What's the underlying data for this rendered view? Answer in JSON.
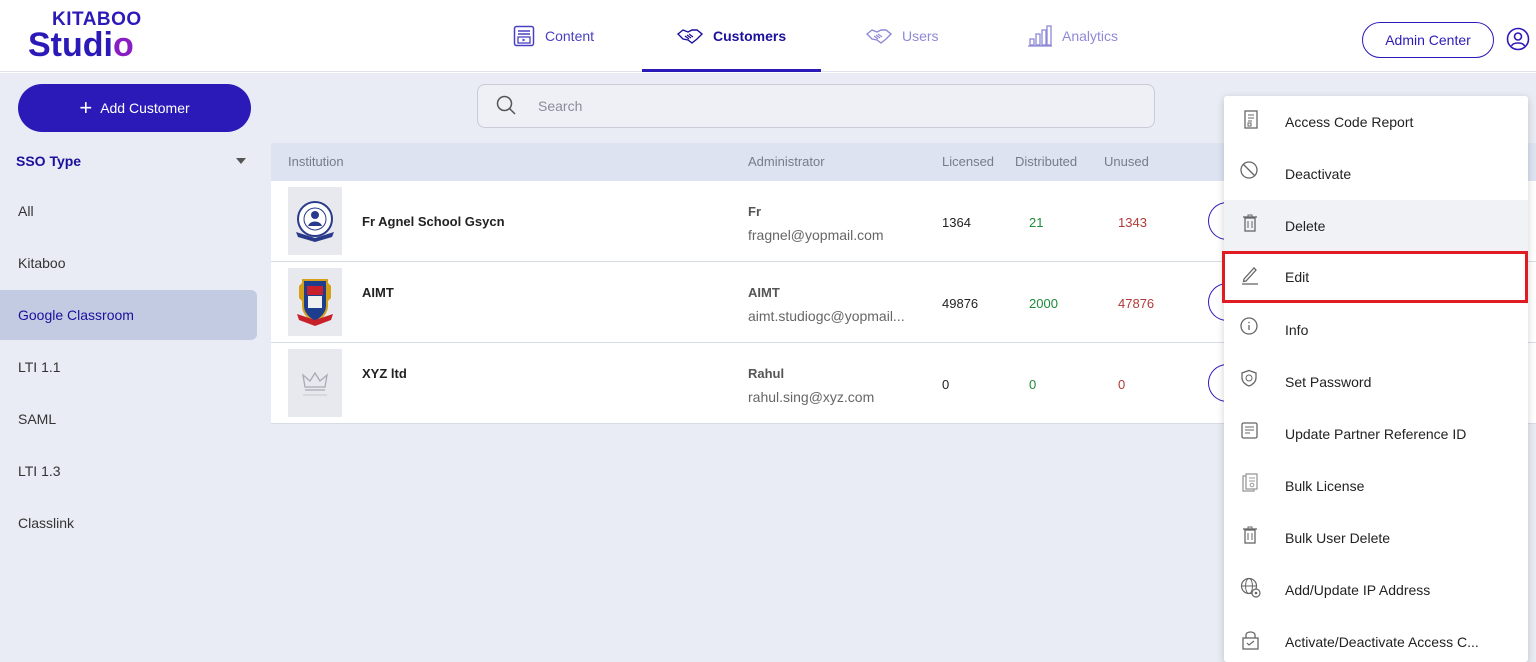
{
  "logo": {
    "top": "KITABOO",
    "bottom_main": "Studi",
    "bottom_accent": "o"
  },
  "nav": {
    "content": "Content",
    "customers": "Customers",
    "users": "Users",
    "analytics": "Analytics"
  },
  "header": {
    "admin_center": "Admin Center"
  },
  "sidebar": {
    "add_customer": "Add Customer",
    "sso_type": "SSO Type",
    "items": [
      "All",
      "Kitaboo",
      "Google Classroom",
      "LTI 1.1",
      "SAML",
      "LTI 1.3",
      "Classlink"
    ],
    "selected": "Google Classroom"
  },
  "search": {
    "placeholder": "Search"
  },
  "table": {
    "columns": {
      "institution": "Institution",
      "administrator": "Administrator",
      "licensed": "Licensed",
      "distributed": "Distributed",
      "unused": "Unused"
    },
    "rows": [
      {
        "institution": "Fr Agnel School Gsycn",
        "admin_name": "Fr",
        "admin_email": "fragnel@yopmail.com",
        "licensed": "1364",
        "distributed": "21",
        "unused": "1343"
      },
      {
        "institution": "AIMT",
        "admin_name": "AIMT",
        "admin_email": "aimt.studiogc@yopmail...",
        "licensed": "49876",
        "distributed": "2000",
        "unused": "47876"
      },
      {
        "institution": "XYZ ltd",
        "admin_name": "Rahul",
        "admin_email": "rahul.sing@xyz.com",
        "licensed": "0",
        "distributed": "0",
        "unused": "0"
      }
    ]
  },
  "menu": {
    "items": [
      {
        "label": "Access Code Report",
        "icon": "report-icon"
      },
      {
        "label": "Deactivate",
        "icon": "ban-icon"
      },
      {
        "label": "Delete",
        "icon": "trash-icon"
      },
      {
        "label": "Edit",
        "icon": "pencil-icon"
      },
      {
        "label": "Info",
        "icon": "info-icon"
      },
      {
        "label": "Set Password",
        "icon": "shield-icon"
      },
      {
        "label": "Update Partner Reference ID",
        "icon": "id-card-icon"
      },
      {
        "label": "Bulk License",
        "icon": "bulk-license-icon"
      },
      {
        "label": "Bulk User Delete",
        "icon": "trash-icon"
      },
      {
        "label": "Add/Update IP Address",
        "icon": "globe-icon"
      },
      {
        "label": "Activate/Deactivate Access C...",
        "icon": "lock-icon"
      }
    ],
    "highlighted": "Edit"
  },
  "colors": {
    "brand": "#2b1ab8",
    "accent": "#8a1cc4",
    "highlight": "#e01b22",
    "distributed": "#1f8a3a",
    "unused": "#b23a3a"
  }
}
